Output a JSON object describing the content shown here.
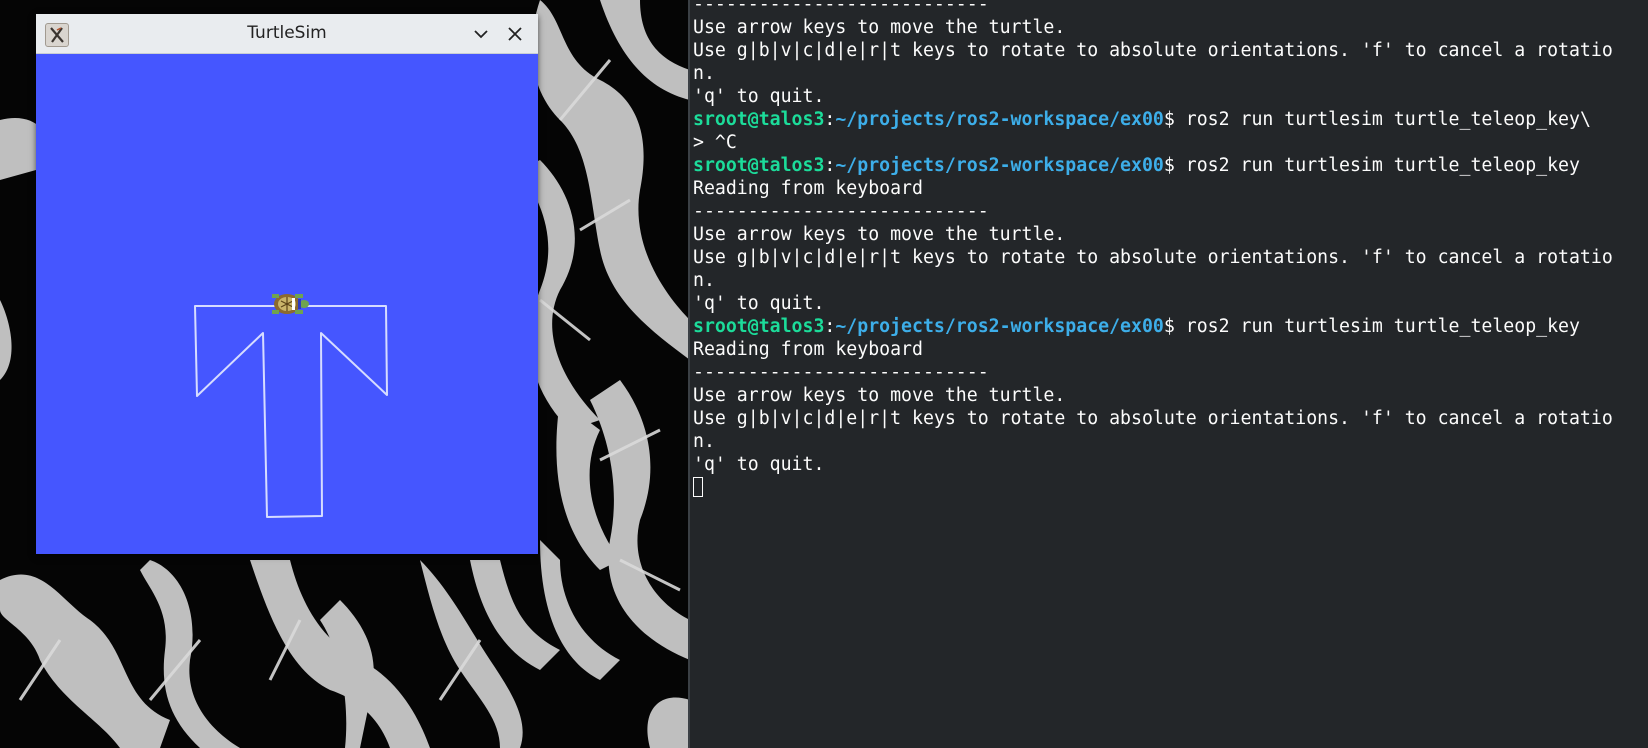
{
  "window": {
    "title": "TurtleSim",
    "background_color": "#4556ff",
    "pen_color": "#d6dcff",
    "icons": [
      "x11-app-icon",
      "minimize-icon",
      "close-icon"
    ]
  },
  "terminal": {
    "colors": {
      "background": "#232629",
      "text": "#fcfcfc",
      "user": "#1cdc9a",
      "path": "#3daee9"
    },
    "lines": [
      {
        "text": "---------------------------"
      },
      {
        "text": "Use arrow keys to move the turtle."
      },
      {
        "text": "Use g|b|v|c|d|e|r|t keys to rotate to absolute orientations. 'f' to cancel a rotatio"
      },
      {
        "text": "n."
      },
      {
        "text": "'q' to quit."
      },
      {
        "prompt": {
          "user": "sroot@talos3",
          "sep": ":",
          "path": "~/projects/ros2-workspace/ex00",
          "sym": "$"
        },
        "text": " ros2 run turtlesim turtle_teleop_key\\"
      },
      {
        "text": "> ^C"
      },
      {
        "prompt": {
          "user": "sroot@talos3",
          "sep": ":",
          "path": "~/projects/ros2-workspace/ex00",
          "sym": "$"
        },
        "text": " ros2 run turtlesim turtle_teleop_key"
      },
      {
        "text": "Reading from keyboard"
      },
      {
        "text": "---------------------------"
      },
      {
        "text": "Use arrow keys to move the turtle."
      },
      {
        "text": "Use g|b|v|c|d|e|r|t keys to rotate to absolute orientations. 'f' to cancel a rotatio"
      },
      {
        "text": "n."
      },
      {
        "text": "'q' to quit."
      },
      {
        "prompt": {
          "user": "sroot@talos3",
          "sep": ":",
          "path": "~/projects/ros2-workspace/ex00",
          "sym": "$"
        },
        "text": " ros2 run turtlesim turtle_teleop_key"
      },
      {
        "text": "Reading from keyboard"
      },
      {
        "text": "---------------------------"
      },
      {
        "text": "Use arrow keys to move the turtle."
      },
      {
        "text": "Use g|b|v|c|d|e|r|t keys to rotate to absolute orientations. 'f' to cancel a rotatio"
      },
      {
        "text": "n."
      },
      {
        "text": "'q' to quit."
      }
    ]
  }
}
